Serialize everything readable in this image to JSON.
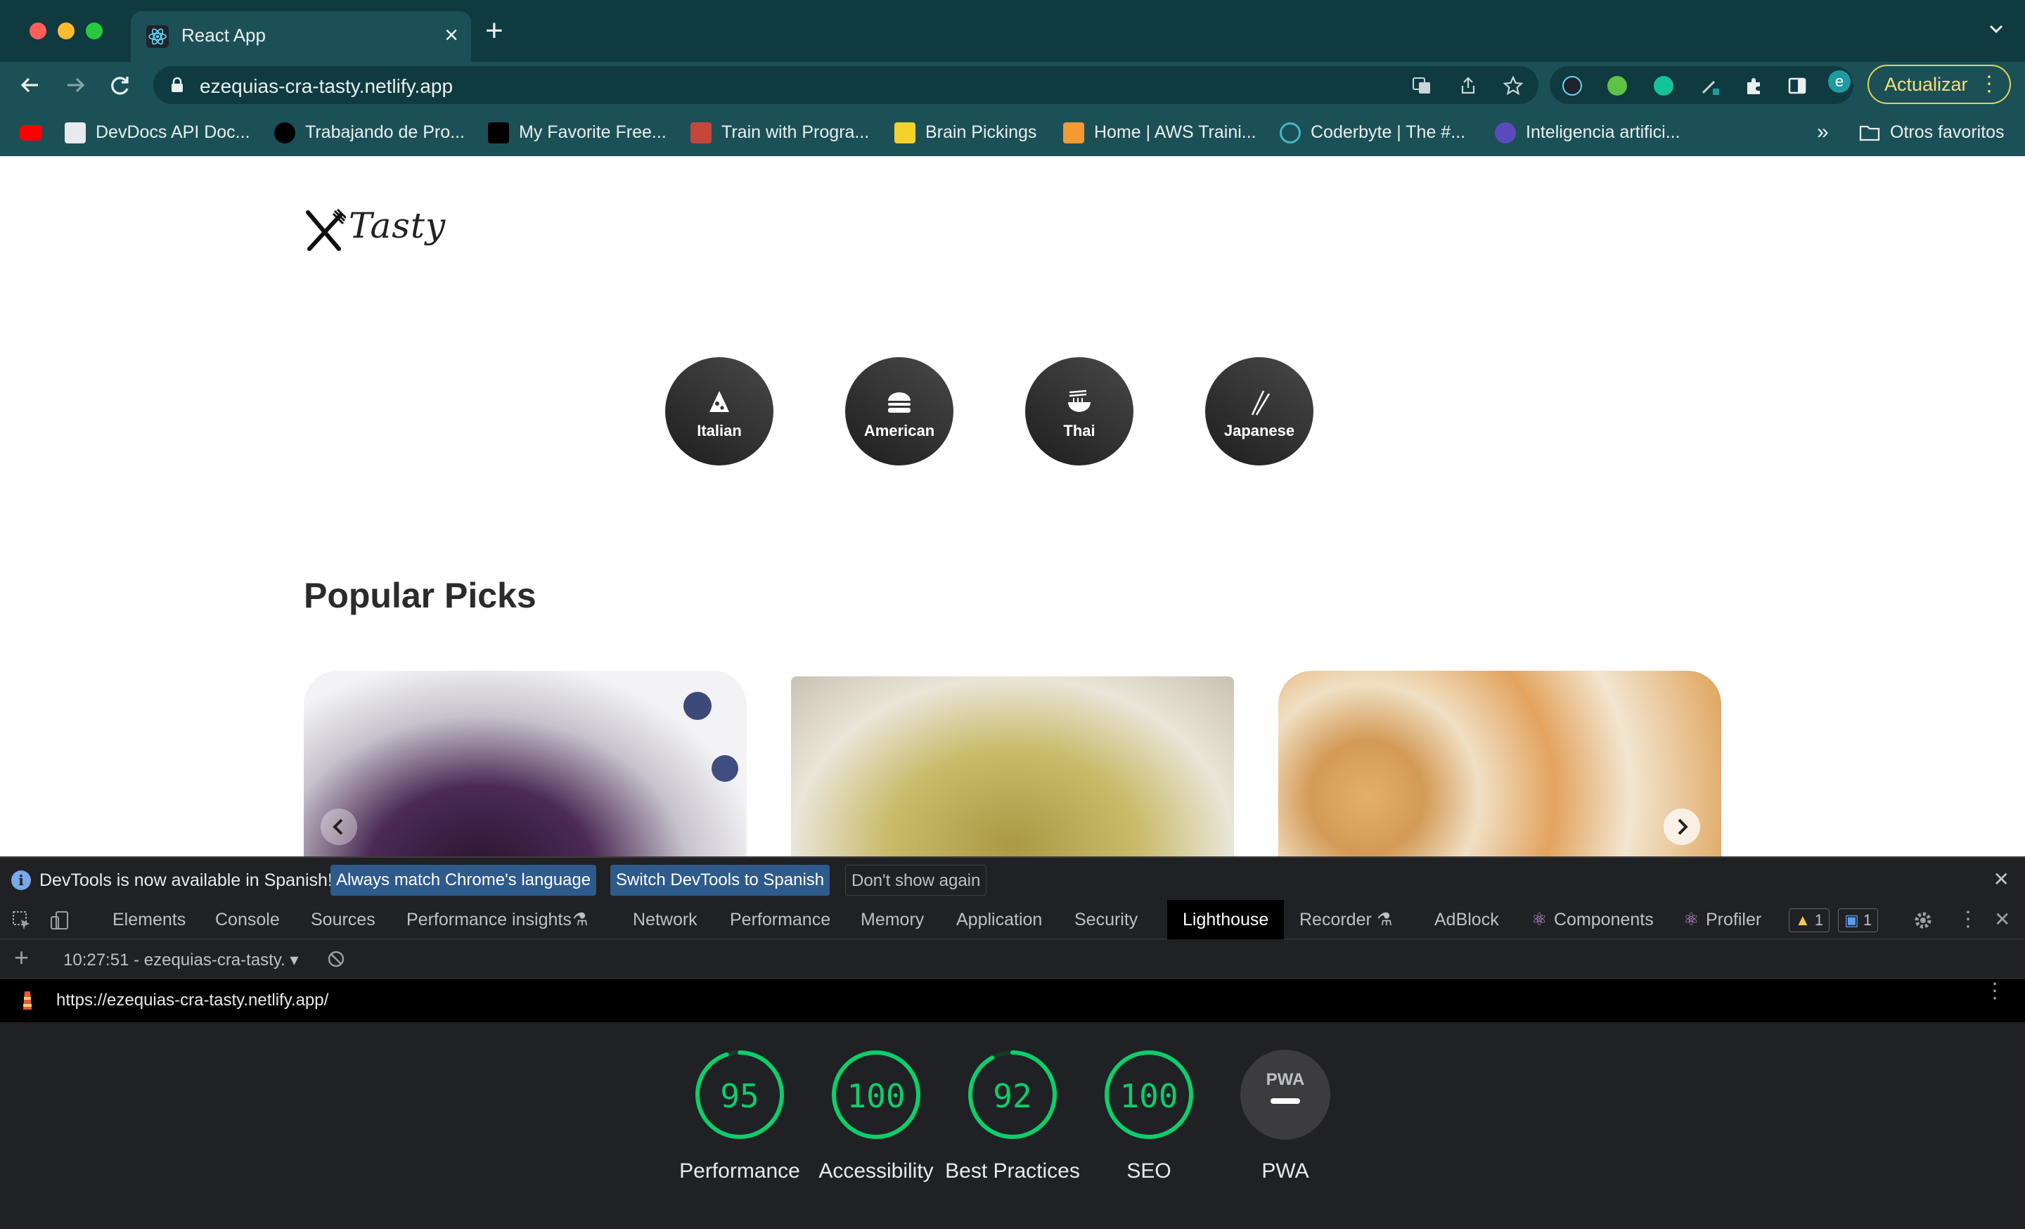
{
  "browser": {
    "tab_title": "React App",
    "url": "ezequias-cra-tasty.netlify.app",
    "update_label": "Actualizar",
    "profile_initial": "e",
    "bookmarks": [
      {
        "label": "",
        "icon": "youtube-icon"
      },
      {
        "label": "DevDocs API Doc...",
        "icon": "devdocs-icon"
      },
      {
        "label": "Trabajando de Pro...",
        "icon": "g-icon"
      },
      {
        "label": "My Favorite Free...",
        "icon": "medium-icon"
      },
      {
        "label": "Train with Progra...",
        "icon": "train-icon"
      },
      {
        "label": "Brain Pickings",
        "icon": "brainpickings-icon"
      },
      {
        "label": "Home | AWS Traini...",
        "icon": "aws-icon"
      },
      {
        "label": "Coderbyte | The #...",
        "icon": "coderbyte-icon"
      },
      {
        "label": "Inteligencia artifici...",
        "icon": "ai-icon"
      }
    ],
    "bookmarks_overflow": "»",
    "other_bookmarks": "Otros favoritos"
  },
  "page": {
    "logo_text": "Tasty",
    "categories": [
      "Italian",
      "American",
      "Thai",
      "Japanese"
    ],
    "section_title": "Popular Picks"
  },
  "devtools": {
    "infobar": {
      "message": "DevTools is now available in Spanish!",
      "btn_match": "Always match Chrome's language",
      "btn_switch": "Switch DevTools to Spanish",
      "btn_dismiss": "Don't show again"
    },
    "tabs": [
      "Elements",
      "Console",
      "Sources",
      "Performance insights",
      "Network",
      "Performance",
      "Memory",
      "Application",
      "Security",
      "Lighthouse",
      "Recorder",
      "AdBlock",
      "Components",
      "Profiler"
    ],
    "warnings_count": "1",
    "messages_count": "1",
    "run_label": "10:27:51 - ezequias-cra-tasty.",
    "report_url": "https://ezequias-cra-tasty.netlify.app/",
    "scores": [
      {
        "value": "95",
        "label": "Performance",
        "fraction": 0.95
      },
      {
        "value": "100",
        "label": "Accessibility",
        "fraction": 1.0
      },
      {
        "value": "92",
        "label": "Best Practices",
        "fraction": 0.92
      },
      {
        "value": "100",
        "label": "SEO",
        "fraction": 1.0
      }
    ],
    "pwa": {
      "badge": "PWA",
      "label": "PWA"
    },
    "colors": {
      "pass": "#0cce6b",
      "accent": "#1a73e8"
    }
  }
}
